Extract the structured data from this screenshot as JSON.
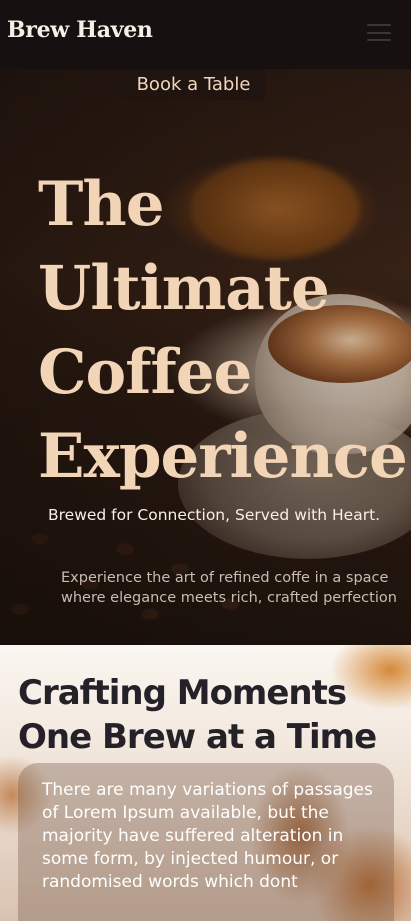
{
  "header": {
    "brand": "Brew Haven",
    "menu_icon": "hamburger-menu-icon"
  },
  "hero": {
    "cta_label": "Book a Table",
    "title_lines": [
      "The",
      "Ultimate",
      "Coffee",
      "Experience"
    ],
    "tagline": "Brewed for Connection, Served with Heart.",
    "description": "Experience the art of refined coffe in a space where elegance meets rich, crafted perfection"
  },
  "about": {
    "title_lines": [
      "Crafting Moments",
      "One Brew at a Time"
    ],
    "body": "There are many variations of passages of Lorem Ipsum available, but the majority have suffered alteration in some form, by injected humour, or randomised words which dont"
  },
  "colors": {
    "accent": "#f2d4b6",
    "header_bg": "#161110",
    "heading_dark": "#242228"
  }
}
